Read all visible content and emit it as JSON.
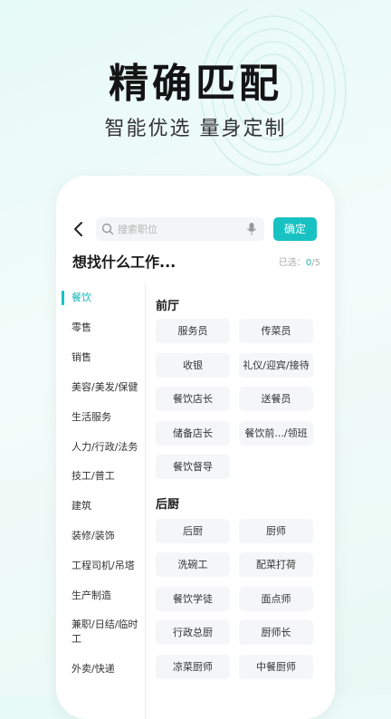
{
  "hero": {
    "title": "精确匹配",
    "subtitle": "智能优选 量身定制"
  },
  "topbar": {
    "search_placeholder": "搜索职位",
    "confirm_label": "确定"
  },
  "heading": "想找什么工作...",
  "count": {
    "label": "已选：",
    "selected": "0",
    "total": "/5"
  },
  "categories": [
    "餐饮",
    "零售",
    "销售",
    "美容/美发/保健",
    "生活服务",
    "人力/行政/法务",
    "技工/普工",
    "建筑",
    "装修/装饰",
    "工程司机/吊塔",
    "生产制造",
    "兼职/日结/临时工",
    "外卖/快递"
  ],
  "sections": [
    {
      "title": "前厅",
      "tags": [
        "服务员",
        "传菜员",
        "收银",
        "礼仪/迎宾/接待",
        "餐饮店长",
        "送餐员",
        "储备店长",
        "餐饮前.../领班",
        "餐饮督导"
      ]
    },
    {
      "title": "后厨",
      "tags": [
        "后厨",
        "厨师",
        "洗碗工",
        "配菜打荷",
        "餐饮学徒",
        "面点师",
        "行政总厨",
        "厨师长",
        "凉菜厨师",
        "中餐厨师"
      ]
    }
  ],
  "colors": {
    "accent": "#18c2c2",
    "text": "#141414"
  }
}
